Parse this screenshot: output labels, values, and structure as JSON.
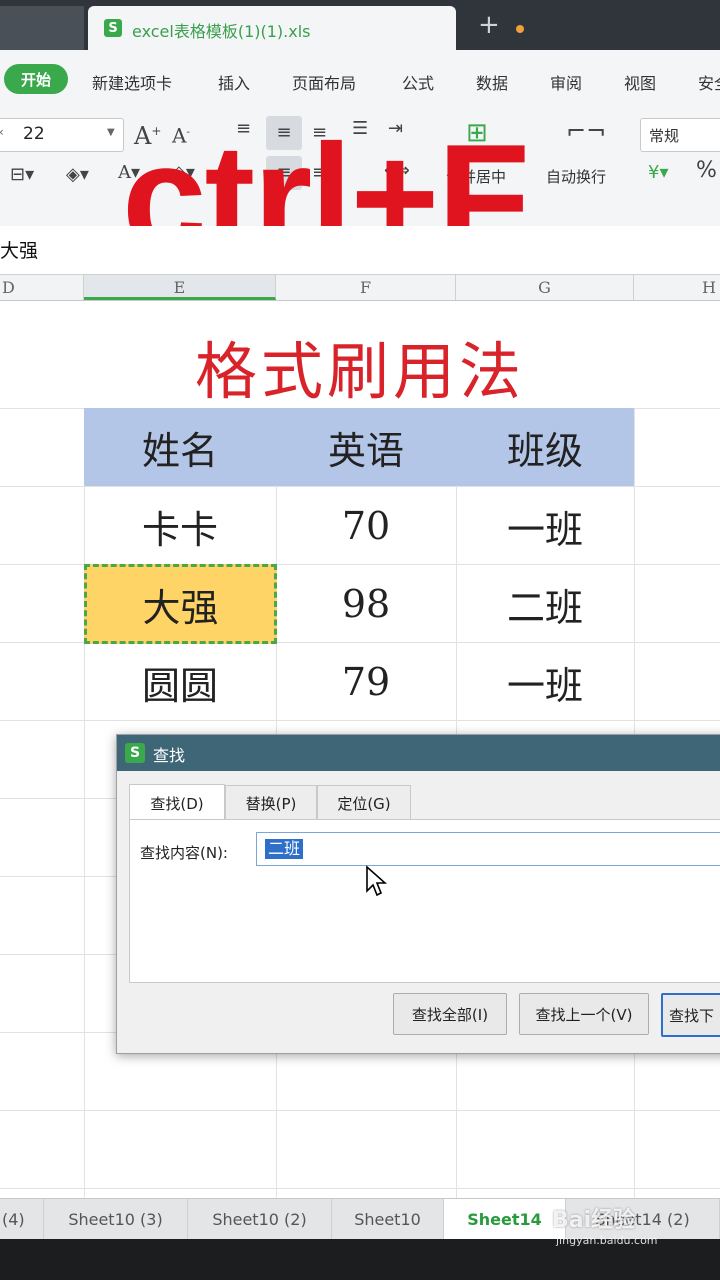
{
  "window": {
    "doc_tab_title": "excel表格模板(1)(1).xls",
    "new_tab_symbol": "+",
    "app_icon_letter": "S"
  },
  "menu": {
    "start": "开始",
    "items": [
      "新建选项卡",
      "插入",
      "页面布局",
      "公式",
      "数据",
      "审阅",
      "视图",
      "安全"
    ]
  },
  "ribbon": {
    "font_size": "22",
    "merge_center": "合并居中",
    "auto_wrap": "自动换行",
    "number_format": "常规",
    "percent": "%"
  },
  "overlay_text": "ctrl+F",
  "formula_bar": {
    "content": "大强"
  },
  "columns": [
    "D",
    "E",
    "F",
    "G",
    "H"
  ],
  "sheet": {
    "title": "格式刷用法",
    "headers": [
      "姓名",
      "英语",
      "班级"
    ],
    "rows": [
      [
        "卡卡",
        "70",
        "一班"
      ],
      [
        "大强",
        "98",
        "二班"
      ],
      [
        "圆圆",
        "79",
        "一班"
      ]
    ]
  },
  "find_dialog": {
    "title": "查找",
    "tabs": [
      "查找(D)",
      "替换(P)",
      "定位(G)"
    ],
    "find_label": "查找内容(N):",
    "find_value": "二班",
    "buttons": {
      "find_all": "查找全部(I)",
      "find_prev": "查找上一个(V)",
      "find_next": "查找下"
    }
  },
  "sheet_tabs": [
    "(4)",
    "Sheet10 (3)",
    "Sheet10 (2)",
    "Sheet10",
    "Sheet14",
    "Sheet14 (2)"
  ],
  "active_sheet_tab": "Sheet14",
  "watermark": {
    "main": "Bai经验",
    "sub": "jingyan.baidu.com"
  },
  "colors": {
    "accent_green": "#3aa94c",
    "overlay_red": "#e0141e",
    "title_red": "#d9232a",
    "header_fill": "#b4c6e7",
    "selected_fill": "#ffd466"
  }
}
